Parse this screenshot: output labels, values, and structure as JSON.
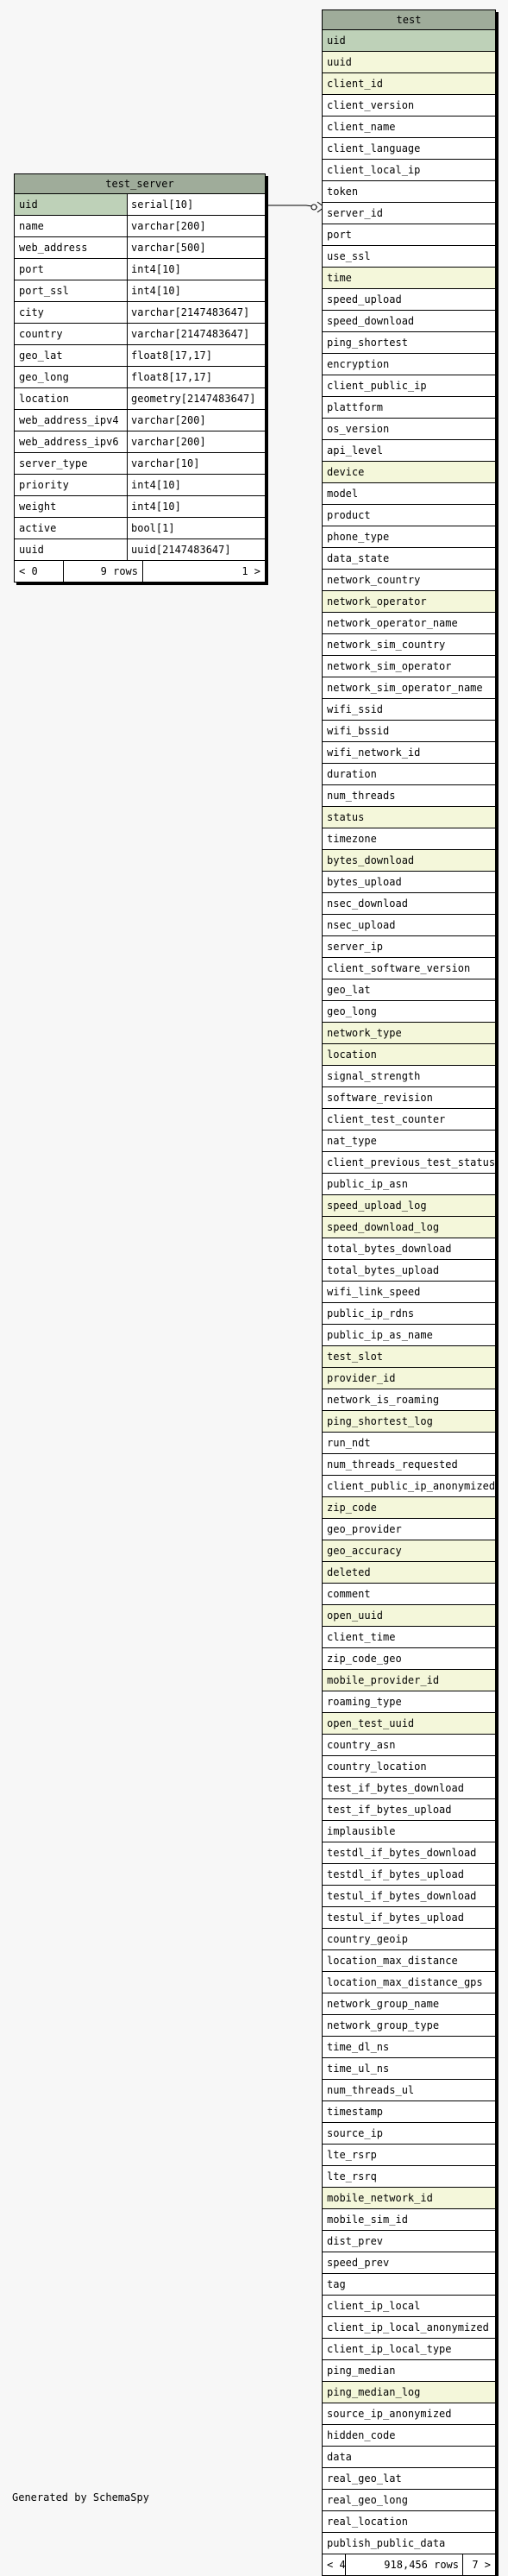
{
  "tables": {
    "test_server": {
      "title": "test_server",
      "rows": [
        {
          "name": "uid",
          "type": "serial[10]",
          "kind": "pk"
        },
        {
          "name": "name",
          "type": "varchar[200]"
        },
        {
          "name": "web_address",
          "type": "varchar[500]"
        },
        {
          "name": "port",
          "type": "int4[10]"
        },
        {
          "name": "port_ssl",
          "type": "int4[10]"
        },
        {
          "name": "city",
          "type": "varchar[2147483647]"
        },
        {
          "name": "country",
          "type": "varchar[2147483647]"
        },
        {
          "name": "geo_lat",
          "type": "float8[17,17]"
        },
        {
          "name": "geo_long",
          "type": "float8[17,17]"
        },
        {
          "name": "location",
          "type": "geometry[2147483647]"
        },
        {
          "name": "web_address_ipv4",
          "type": "varchar[200]"
        },
        {
          "name": "web_address_ipv6",
          "type": "varchar[200]"
        },
        {
          "name": "server_type",
          "type": "varchar[10]"
        },
        {
          "name": "priority",
          "type": "int4[10]"
        },
        {
          "name": "weight",
          "type": "int4[10]"
        },
        {
          "name": "active",
          "type": "bool[1]"
        },
        {
          "name": "uuid",
          "type": "uuid[2147483647]"
        }
      ],
      "footer": {
        "left": "< 0",
        "mid": "9 rows",
        "right": "1 >"
      }
    },
    "test": {
      "title": "test",
      "rows": [
        {
          "name": "uid",
          "kind": "pk"
        },
        {
          "name": "uuid",
          "kind": "key"
        },
        {
          "name": "client_id",
          "kind": "key"
        },
        {
          "name": "client_version"
        },
        {
          "name": "client_name"
        },
        {
          "name": "client_language"
        },
        {
          "name": "client_local_ip"
        },
        {
          "name": "token"
        },
        {
          "name": "server_id"
        },
        {
          "name": "port"
        },
        {
          "name": "use_ssl"
        },
        {
          "name": "time",
          "kind": "key"
        },
        {
          "name": "speed_upload"
        },
        {
          "name": "speed_download"
        },
        {
          "name": "ping_shortest"
        },
        {
          "name": "encryption"
        },
        {
          "name": "client_public_ip"
        },
        {
          "name": "plattform"
        },
        {
          "name": "os_version"
        },
        {
          "name": "api_level"
        },
        {
          "name": "device",
          "kind": "key"
        },
        {
          "name": "model"
        },
        {
          "name": "product"
        },
        {
          "name": "phone_type"
        },
        {
          "name": "data_state"
        },
        {
          "name": "network_country"
        },
        {
          "name": "network_operator",
          "kind": "key"
        },
        {
          "name": "network_operator_name"
        },
        {
          "name": "network_sim_country"
        },
        {
          "name": "network_sim_operator"
        },
        {
          "name": "network_sim_operator_name"
        },
        {
          "name": "wifi_ssid"
        },
        {
          "name": "wifi_bssid"
        },
        {
          "name": "wifi_network_id"
        },
        {
          "name": "duration"
        },
        {
          "name": "num_threads"
        },
        {
          "name": "status",
          "kind": "key"
        },
        {
          "name": "timezone"
        },
        {
          "name": "bytes_download",
          "kind": "key"
        },
        {
          "name": "bytes_upload"
        },
        {
          "name": "nsec_download"
        },
        {
          "name": "nsec_upload"
        },
        {
          "name": "server_ip"
        },
        {
          "name": "client_software_version"
        },
        {
          "name": "geo_lat"
        },
        {
          "name": "geo_long"
        },
        {
          "name": "network_type",
          "kind": "key"
        },
        {
          "name": "location",
          "kind": "key"
        },
        {
          "name": "signal_strength"
        },
        {
          "name": "software_revision"
        },
        {
          "name": "client_test_counter"
        },
        {
          "name": "nat_type"
        },
        {
          "name": "client_previous_test_status"
        },
        {
          "name": "public_ip_asn"
        },
        {
          "name": "speed_upload_log",
          "kind": "key"
        },
        {
          "name": "speed_download_log",
          "kind": "key"
        },
        {
          "name": "total_bytes_download"
        },
        {
          "name": "total_bytes_upload"
        },
        {
          "name": "wifi_link_speed"
        },
        {
          "name": "public_ip_rdns"
        },
        {
          "name": "public_ip_as_name"
        },
        {
          "name": "test_slot",
          "kind": "key"
        },
        {
          "name": "provider_id",
          "kind": "key"
        },
        {
          "name": "network_is_roaming"
        },
        {
          "name": "ping_shortest_log",
          "kind": "key"
        },
        {
          "name": "run_ndt"
        },
        {
          "name": "num_threads_requested"
        },
        {
          "name": "client_public_ip_anonymized"
        },
        {
          "name": "zip_code",
          "kind": "key"
        },
        {
          "name": "geo_provider"
        },
        {
          "name": "geo_accuracy",
          "kind": "key"
        },
        {
          "name": "deleted",
          "kind": "key"
        },
        {
          "name": "comment"
        },
        {
          "name": "open_uuid",
          "kind": "key"
        },
        {
          "name": "client_time"
        },
        {
          "name": "zip_code_geo"
        },
        {
          "name": "mobile_provider_id",
          "kind": "key"
        },
        {
          "name": "roaming_type"
        },
        {
          "name": "open_test_uuid",
          "kind": "key"
        },
        {
          "name": "country_asn"
        },
        {
          "name": "country_location"
        },
        {
          "name": "test_if_bytes_download"
        },
        {
          "name": "test_if_bytes_upload"
        },
        {
          "name": "implausible"
        },
        {
          "name": "testdl_if_bytes_download"
        },
        {
          "name": "testdl_if_bytes_upload"
        },
        {
          "name": "testul_if_bytes_download"
        },
        {
          "name": "testul_if_bytes_upload"
        },
        {
          "name": "country_geoip"
        },
        {
          "name": "location_max_distance"
        },
        {
          "name": "location_max_distance_gps"
        },
        {
          "name": "network_group_name"
        },
        {
          "name": "network_group_type"
        },
        {
          "name": "time_dl_ns"
        },
        {
          "name": "time_ul_ns"
        },
        {
          "name": "num_threads_ul"
        },
        {
          "name": "timestamp"
        },
        {
          "name": "source_ip"
        },
        {
          "name": "lte_rsrp"
        },
        {
          "name": "lte_rsrq"
        },
        {
          "name": "mobile_network_id",
          "kind": "key"
        },
        {
          "name": "mobile_sim_id"
        },
        {
          "name": "dist_prev"
        },
        {
          "name": "speed_prev"
        },
        {
          "name": "tag"
        },
        {
          "name": "client_ip_local"
        },
        {
          "name": "client_ip_local_anonymized"
        },
        {
          "name": "client_ip_local_type"
        },
        {
          "name": "ping_median"
        },
        {
          "name": "ping_median_log",
          "kind": "key"
        },
        {
          "name": "source_ip_anonymized"
        },
        {
          "name": "hidden_code"
        },
        {
          "name": "data"
        },
        {
          "name": "real_geo_lat"
        },
        {
          "name": "real_geo_long"
        },
        {
          "name": "real_location"
        },
        {
          "name": "publish_public_data"
        }
      ],
      "footer": {
        "left": "< 4",
        "mid": "918,456 rows",
        "right": "7 >"
      }
    }
  },
  "relationships": [
    {
      "from": "test.server_id",
      "to": "test_server.uid"
    }
  ],
  "footer_text": "Generated by SchemaSpy",
  "colors": {
    "header": "#9fac9a",
    "primary_key": "#bed1b8",
    "key_column": "#f4f7da",
    "background": "#f7f7f7"
  }
}
